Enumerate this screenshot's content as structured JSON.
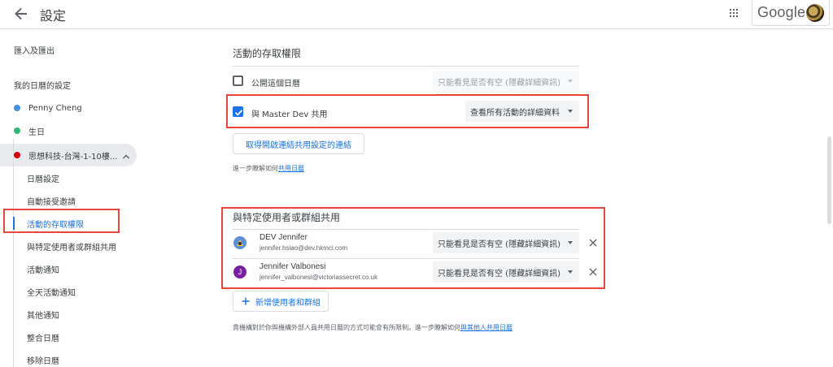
{
  "header": {
    "title": "設定",
    "google_logo": "Google",
    "back_icon": "arrow-left-icon",
    "apps_icon": "apps-grid-icon"
  },
  "sidebar": {
    "import_export": "匯入及匯出",
    "my_calendars_heading": "我的日曆的設定",
    "calendars": [
      {
        "label": "Penny Cheng",
        "color": "#4a90e2"
      },
      {
        "label": "生日",
        "color": "#33b679"
      },
      {
        "label": "思想科技-台灣-1-10樓...",
        "color": "#d50000"
      }
    ],
    "sub_items": [
      "日曆設定",
      "自動接受邀請",
      "活動的存取權限",
      "與特定使用者或群組共用",
      "活動通知",
      "全天活動通知",
      "其他通知",
      "整合日曆",
      "移除日曆"
    ],
    "active_sub_item": "活動的存取權限"
  },
  "access": {
    "title": "活動的存取權限",
    "public_label": "公開這個日曆",
    "public_checked": false,
    "public_option": "只能看見是否有空 (隱藏詳細資訊)",
    "share_label": "與 Master Dev 共用",
    "share_checked": true,
    "share_option": "查看所有活動的詳細資料",
    "link_button": "取得開啟連結共用設定的連結",
    "learn_more_prefix": "進一步瞭解如何",
    "learn_more_link": "共用日曆"
  },
  "specific": {
    "title": "與特定使用者或群組共用",
    "people": [
      {
        "name": "DEV Jennifer",
        "email": "jennifer.hsiao@dev.hkmci.com",
        "permission": "只能看見是否有空 (隱藏詳細資訊)",
        "avatar_color": "#5b8fd6",
        "initial": ""
      },
      {
        "name": "Jennifer Valbonesi",
        "email": "jennifer_valbonesi@victoriassecret.co.uk",
        "permission": "只能看見是否有空 (隱藏詳細資訊)",
        "avatar_color": "#7b1fa2",
        "initial": "J"
      }
    ],
    "add_button": "新增使用者和群組",
    "note_prefix": "貴機構對於你與機構外部人員共用日曆的方式可能會有所限制。進一步瞭解如何",
    "note_link": "與其他人共用日曆"
  }
}
